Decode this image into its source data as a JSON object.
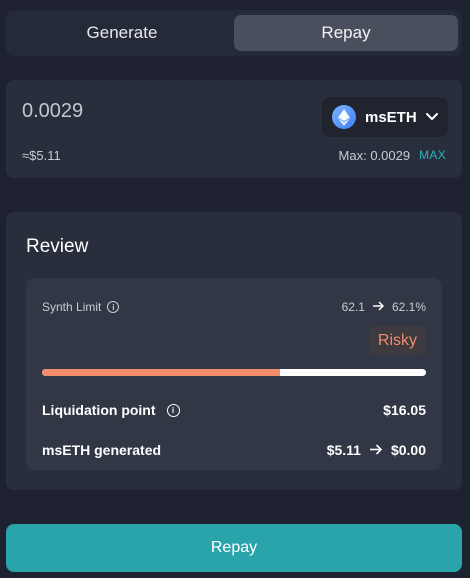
{
  "tabs": [
    {
      "label": "Generate",
      "active": false
    },
    {
      "label": "Repay",
      "active": true
    }
  ],
  "amount": {
    "value": "0.0029",
    "usd_value": "≈$5.11",
    "max_label": "Max: 0.0029",
    "max_button": "MAX",
    "token": {
      "label": "msETH",
      "icon": "ethereum-icon",
      "chevron": "chevron-down-icon"
    }
  },
  "review": {
    "title": "Review",
    "synth_limit": {
      "label": "Synth Limit",
      "from": "62.1",
      "to": "62.1%",
      "badge": "Risky",
      "progress_percent": 62.1
    },
    "liquidation": {
      "label": "Liquidation point",
      "value": "$16.05"
    },
    "generated": {
      "label": "msETH generated",
      "from": "$5.11",
      "to": "$0.00"
    }
  },
  "repay_button": "Repay",
  "colors": {
    "background": "#1e2230",
    "card": "#292e3d",
    "accent": "#2aa4ab",
    "risky": "#f28c6b"
  }
}
